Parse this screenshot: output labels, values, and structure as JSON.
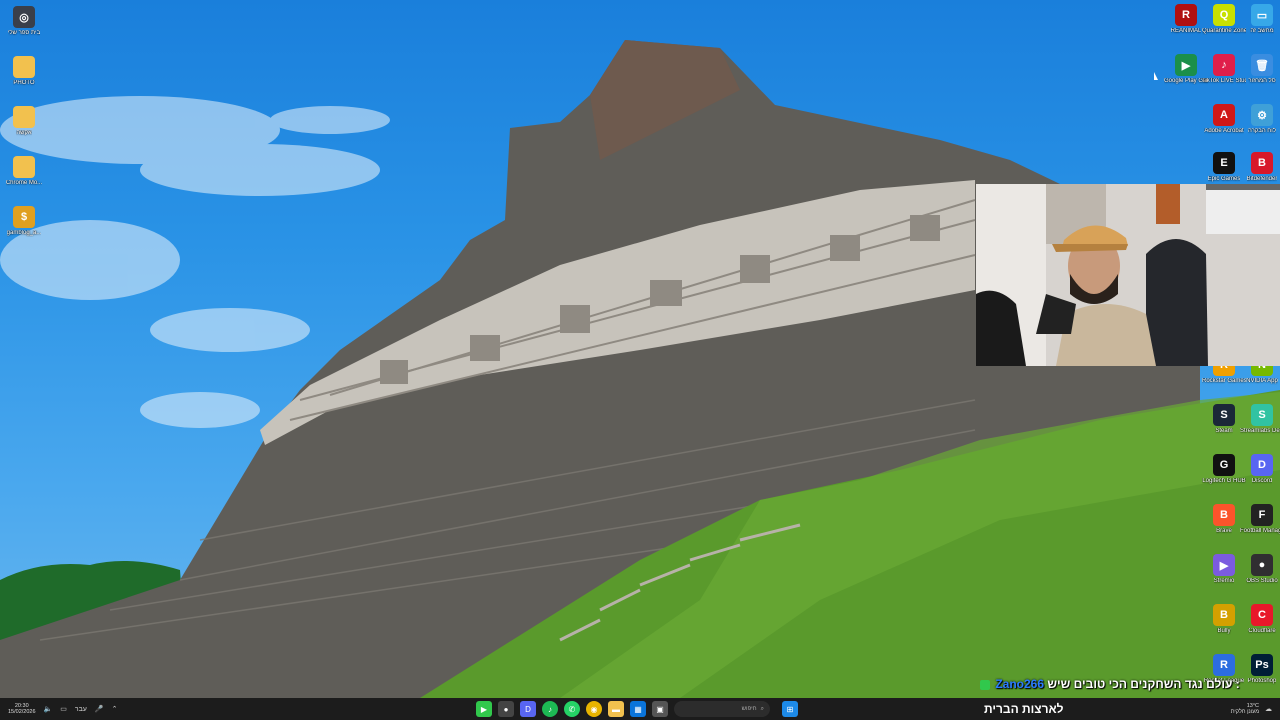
{
  "desktop_icons_left": [
    {
      "name": "steam-like-app-icon",
      "label": "בית ספר\nשלי",
      "color": "#3a3f4a",
      "glyph": "◎"
    },
    {
      "name": "photos-folder-icon",
      "label": "PHOTO",
      "color": "#f2c14e",
      "glyph": ""
    },
    {
      "name": "folder-icon",
      "label": "אקשה",
      "color": "#f2c14e",
      "glyph": ""
    },
    {
      "name": "drive-folder-icon",
      "label": "Chrome Mo...",
      "color": "#f2c14e",
      "glyph": ""
    },
    {
      "name": "coin-app-icon",
      "label": "gamblog_a...",
      "color": "#e0a020",
      "glyph": "$"
    }
  ],
  "desktop_icons_right": [
    {
      "label": "REANIMAL",
      "color": "#b01010",
      "glyph": "R"
    },
    {
      "label": "Quarantine Zone The...",
      "color": "#c8e000",
      "glyph": "Q"
    },
    {
      "label": "מחשב זה",
      "color": "#37a8e8",
      "glyph": "▭"
    },
    {
      "label": "Google Play Games",
      "color": "#1b8f4a",
      "glyph": "▶"
    },
    {
      "label": "TikTok LIVE Studio",
      "color": "#e01e4a",
      "glyph": "♪"
    },
    {
      "label": "סל המחזור",
      "color": "#3a8de0",
      "glyph": "🗑"
    },
    {
      "label": "Adobe Acrobat",
      "color": "#d01818",
      "glyph": "A"
    },
    {
      "label": "Epic Games",
      "color": "#111111",
      "glyph": "E"
    },
    {
      "label": "לוח הבקרה",
      "color": "#3fa0d8",
      "glyph": "⚙"
    },
    {
      "label": "Bitdefender",
      "color": "#d8182a",
      "glyph": "B"
    },
    {
      "label": "Rockstar Games",
      "color": "#f0a000",
      "glyph": "R"
    },
    {
      "label": "NVIDIA App",
      "color": "#76b900",
      "glyph": "N"
    },
    {
      "label": "Steam",
      "color": "#1b2838",
      "glyph": "S"
    },
    {
      "label": "Streamlabs Desktop",
      "color": "#31c3a2",
      "glyph": "S"
    },
    {
      "label": "Logitech G HUB",
      "color": "#111111",
      "glyph": "G"
    },
    {
      "label": "Discord",
      "color": "#5865f2",
      "glyph": "D"
    },
    {
      "label": "Brave",
      "color": "#fb542b",
      "glyph": "B"
    },
    {
      "label": "Football Manager",
      "color": "#222222",
      "glyph": "F"
    },
    {
      "label": "Stremio",
      "color": "#7b5bdf",
      "glyph": "▶"
    },
    {
      "label": "OBS Studio",
      "color": "#302e31",
      "glyph": "●"
    },
    {
      "label": "Bully",
      "color": "#d4a000",
      "glyph": "B"
    },
    {
      "label": "Cloudflare",
      "color": "#e8182a",
      "glyph": "C"
    },
    {
      "label": "Rocket League",
      "color": "#2c6de0",
      "glyph": "R"
    },
    {
      "label": "Photoshop",
      "color": "#001e36",
      "glyph": "Ps"
    }
  ],
  "ticker": {
    "user": "Zano266",
    "text": "עולם נגד השחקנים הכי טובים שיש :"
  },
  "taskbar": {
    "time": "20:30",
    "date": "15/02/2026",
    "lang": "עבר",
    "search_placeholder": "חיפוש",
    "banner": "לארצות הברית",
    "weather_temp": "13°C",
    "weather_desc": "מעונן חלקית"
  },
  "colors": {
    "taskbar_bg": "#1c1c1c",
    "sky": "#2a93e6",
    "grass": "#5a9a2c",
    "stone": "#5f5d58"
  }
}
